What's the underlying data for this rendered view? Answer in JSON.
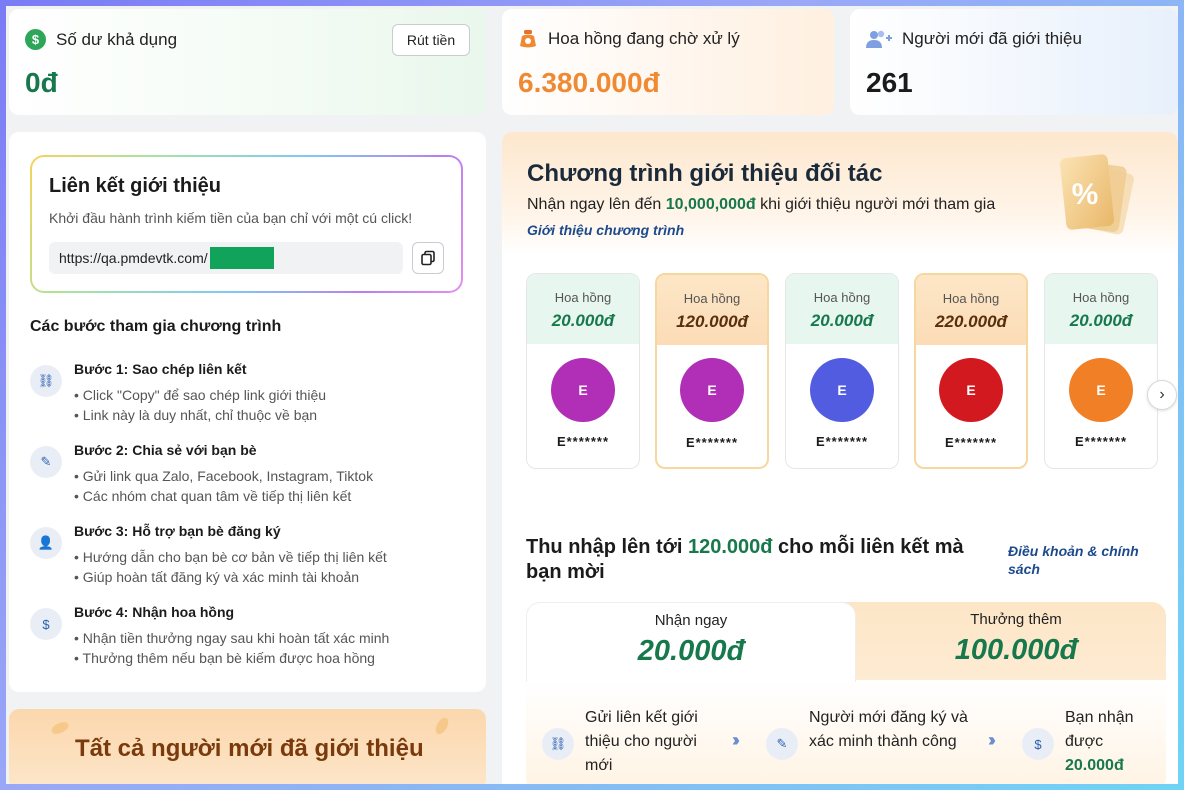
{
  "stats": {
    "balance": {
      "label": "Số dư khả dụng",
      "value": "0đ",
      "button": "Rút tiền",
      "color": "#17784c"
    },
    "pending": {
      "label": "Hoa hồng đang chờ xử lý",
      "value": "6.380.000đ",
      "color": "#f08a32"
    },
    "referred": {
      "label": "Người mới đã giới thiệu",
      "value": "261",
      "color": "#1b1b1b"
    }
  },
  "referral": {
    "title": "Liên kết giới thiệu",
    "subtitle": "Khởi đầu hành trình kiếm tiền của bạn chỉ với một cú click!",
    "link": "https://qa.pmdevtk.com/"
  },
  "steps": {
    "title": "Các bước tham gia chương trình",
    "items": [
      {
        "icon": "link-icon",
        "name": "Bước 1: Sao chép liên kết",
        "lines": [
          "• Click \"Copy\" để sao chép link giới thiệu",
          "• Link này là duy nhất, chỉ thuộc về bạn"
        ]
      },
      {
        "icon": "share-icon",
        "name": "Bước 2: Chia sẻ với bạn bè",
        "lines": [
          "• Gửi link qua Zalo, Facebook, Instagram, Tiktok",
          "• Các nhóm chat quan tâm về tiếp thị liên kết"
        ]
      },
      {
        "icon": "user-plus-icon",
        "name": "Bước 3: Hỗ trợ bạn bè đăng ký",
        "lines": [
          "• Hướng dẫn cho bạn bè cơ bản về tiếp thị liên kết",
          "• Giúp hoàn tất đăng ký và xác minh tài khoản"
        ]
      },
      {
        "icon": "dollar-icon",
        "name": "Bước 4: Nhận hoa hồng",
        "lines": [
          "• Nhận tiền thưởng ngay sau khi hoàn tất xác minh",
          "• Thưởng thêm nếu bạn bè kiếm được hoa hồng"
        ]
      }
    ]
  },
  "all_referred": {
    "title": "Tất cả người mới đã giới thiệu"
  },
  "program": {
    "title": "Chương trình giới thiệu đối tác",
    "sub_before": "Nhận ngay lên đến ",
    "sub_amount": "10,000,000đ",
    "sub_after": " khi giới thiệu người mới tham gia",
    "link": "Giới thiệu chương trình",
    "coupon_symbol": "%"
  },
  "tiers": [
    {
      "label": "Hoa hồng",
      "amount": "20.000đ",
      "initial": "E",
      "name": "E*******",
      "color": "#b02fb6",
      "highlight": false
    },
    {
      "label": "Hoa hồng",
      "amount": "120.000đ",
      "initial": "E",
      "name": "E*******",
      "color": "#b02fb6",
      "highlight": true
    },
    {
      "label": "Hoa hồng",
      "amount": "20.000đ",
      "initial": "E",
      "name": "E*******",
      "color": "#525ce0",
      "highlight": false
    },
    {
      "label": "Hoa hồng",
      "amount": "220.000đ",
      "initial": "E",
      "name": "E*******",
      "color": "#d1191f",
      "highlight": true
    },
    {
      "label": "Hoa hồng",
      "amount": "20.000đ",
      "initial": "E",
      "name": "E*******",
      "color": "#f07f26",
      "highlight": false
    }
  ],
  "earn": {
    "before": "Thu nhập lên tới ",
    "amount": "120.000đ",
    "after": " cho mỗi liên kết mà bạn mời",
    "terms": "Điều khoản & chính sách"
  },
  "bonus": {
    "now_label": "Nhận ngay",
    "now_amount": "20.000đ",
    "extra_label": "Thưởng thêm",
    "extra_amount": "100.000đ"
  },
  "flow": [
    {
      "icon": "link-icon",
      "text": "Gửi liên kết giới thiệu cho người mới"
    },
    {
      "icon": "verify-icon",
      "text": "Người mới đăng ký và xác minh thành công"
    },
    {
      "icon": "dollar-icon",
      "text": "Bạn nhận được",
      "amount": "20.000đ"
    }
  ]
}
